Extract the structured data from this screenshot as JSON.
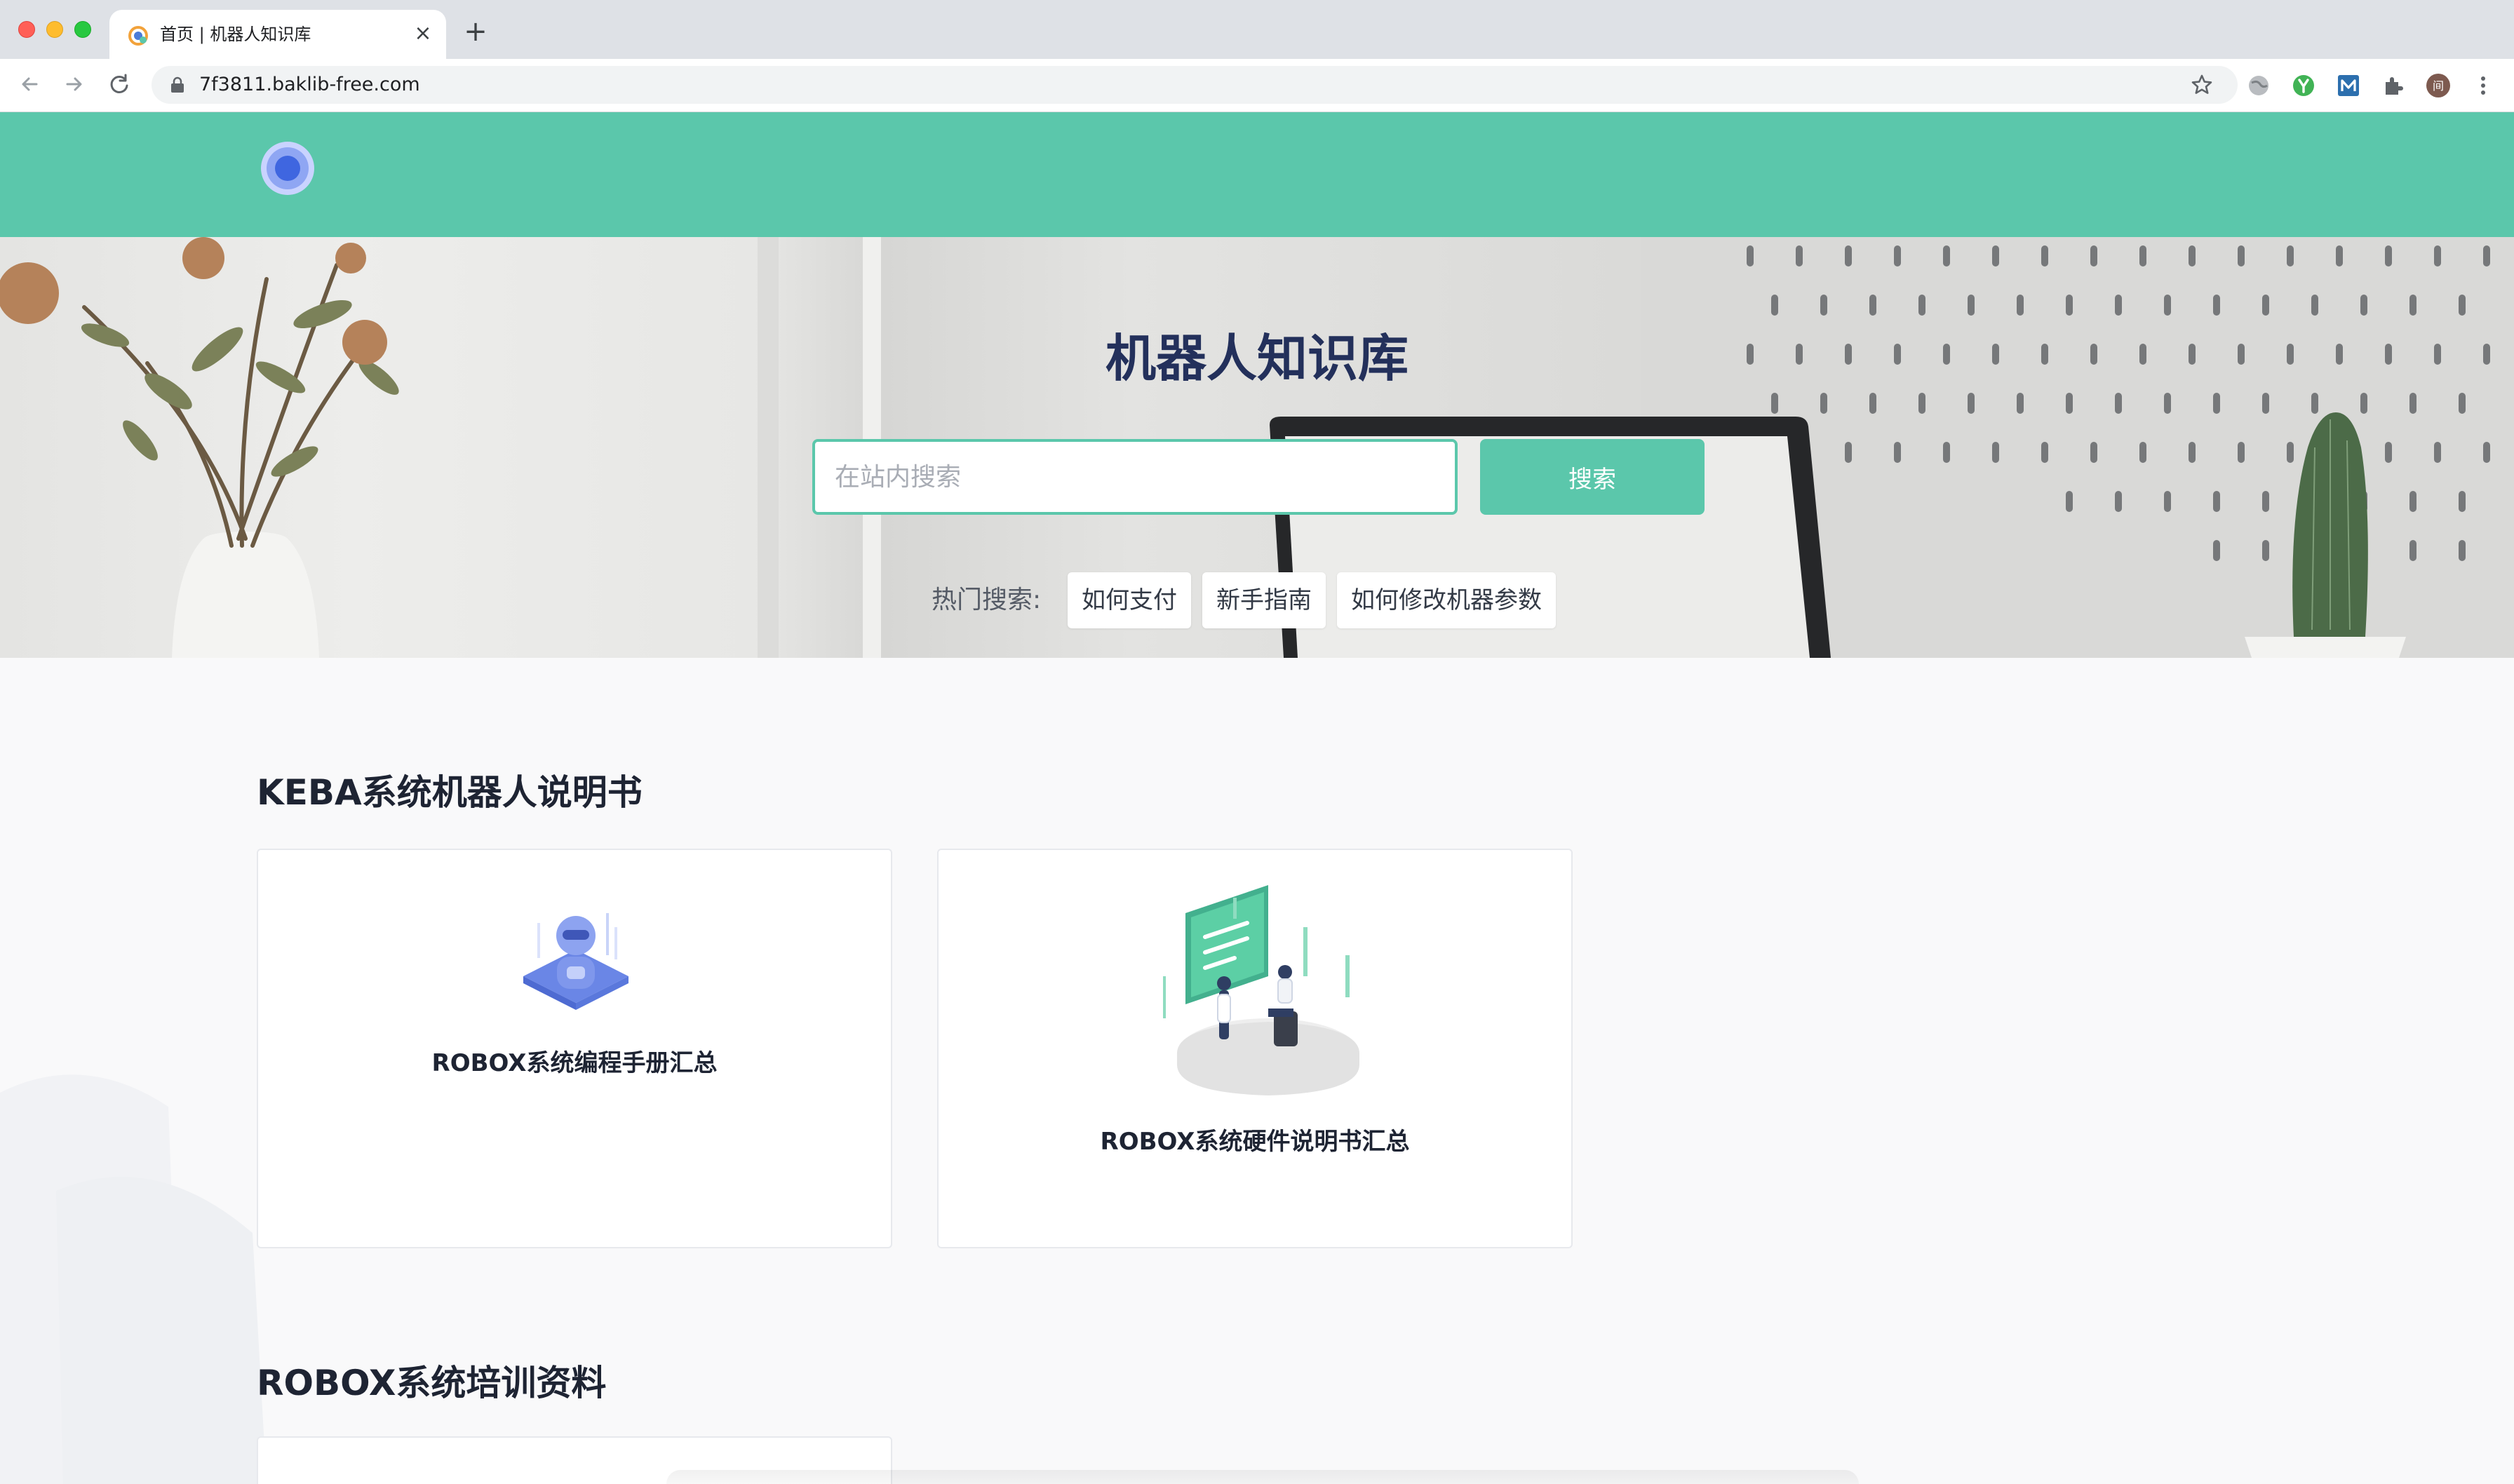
{
  "browser": {
    "tab_title": "首页 | 机器人知识库",
    "url": "7f3811.baklib-free.com",
    "avatar_initial": "间"
  },
  "hero": {
    "title": "机器人知识库",
    "search_placeholder": "在站内搜索",
    "search_button": "搜索",
    "hot_label": "热门搜索:",
    "hot_tags": [
      "如何支付",
      "新手指南",
      "如何修改机器参数"
    ]
  },
  "sections": [
    {
      "title": "KEBA系统机器人说明书",
      "cards": [
        {
          "label": "ROBOX系统编程手册汇总",
          "icon": "robot-illustration"
        },
        {
          "label": "ROBOX系统硬件说明书汇总",
          "icon": "meeting-illustration"
        }
      ]
    },
    {
      "title": "ROBOX系统培训资料",
      "cards": []
    }
  ],
  "colors": {
    "brand": "#5bc7ab",
    "title": "#23305b",
    "text": "#1e2433"
  }
}
